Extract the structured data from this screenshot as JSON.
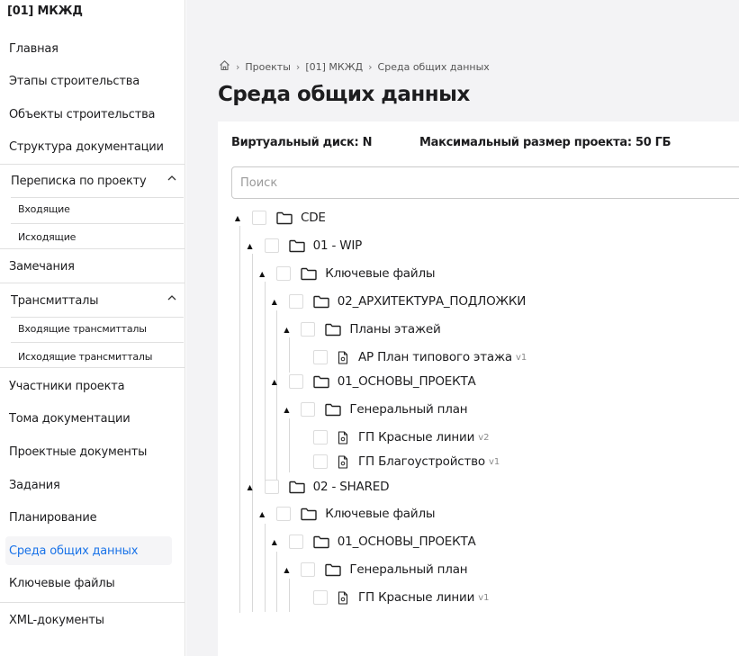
{
  "app": {
    "title": "[01] МКЖД"
  },
  "sidebar": {
    "items": [
      {
        "label": "Главная"
      },
      {
        "label": "Этапы строительства"
      },
      {
        "label": "Объекты строительства"
      },
      {
        "label": "Структура документации"
      },
      {
        "label": "Переписка по проекту",
        "expanded": true,
        "children": [
          {
            "label": "Входящие"
          },
          {
            "label": "Исходящие"
          }
        ]
      },
      {
        "label": "Замечания"
      },
      {
        "label": "Трансмитталы",
        "expanded": true,
        "children": [
          {
            "label": "Входящие трансмитталы"
          },
          {
            "label": "Исходящие трансмитталы"
          }
        ]
      },
      {
        "label": "Участники проекта"
      },
      {
        "label": "Тома документации"
      },
      {
        "label": "Проектные документы"
      },
      {
        "label": "Задания"
      },
      {
        "label": "Планирование"
      },
      {
        "label": "Среда общих данных",
        "active": true
      },
      {
        "label": "Ключевые файлы"
      },
      {
        "label": "XML-документы"
      }
    ],
    "active_color": "#1a73e8"
  },
  "breadcrumb": {
    "items": [
      "Проекты",
      "[01] МКЖД",
      "Среда общих данных"
    ],
    "home_icon": "home-icon"
  },
  "page": {
    "title": "Среда общих данных"
  },
  "info": {
    "virtual_disk": "Виртуальный диск: N",
    "max_size": "Максимальный размер проекта: 50 ГБ"
  },
  "search": {
    "placeholder": "Поиск",
    "value": ""
  },
  "tree": [
    {
      "label": "CDE",
      "type": "folder"
    },
    {
      "label": "01 - WIP",
      "type": "folder"
    },
    {
      "label": "Ключевые файлы",
      "type": "folder"
    },
    {
      "label": "02_АРХИТЕКТУРА_ПОДЛОЖКИ",
      "type": "folder"
    },
    {
      "label": "Планы этажей",
      "type": "folder"
    },
    {
      "label": "АР План типового этажа",
      "type": "file",
      "version": "v1"
    },
    {
      "label": "01_ОСНОВЫ_ПРОЕКТА",
      "type": "folder"
    },
    {
      "label": "Генеральный план",
      "type": "folder"
    },
    {
      "label": "ГП Красные линии",
      "type": "file",
      "version": "v2"
    },
    {
      "label": "ГП Благоустройство",
      "type": "file",
      "version": "v1"
    },
    {
      "label": "02 - SHARED",
      "type": "folder"
    },
    {
      "label": "Ключевые файлы",
      "type": "folder"
    },
    {
      "label": "01_ОСНОВЫ_ПРОЕКТА",
      "type": "folder"
    },
    {
      "label": "Генеральный план",
      "type": "folder"
    },
    {
      "label": "ГП Красные линии",
      "type": "file",
      "version": "v1"
    }
  ]
}
